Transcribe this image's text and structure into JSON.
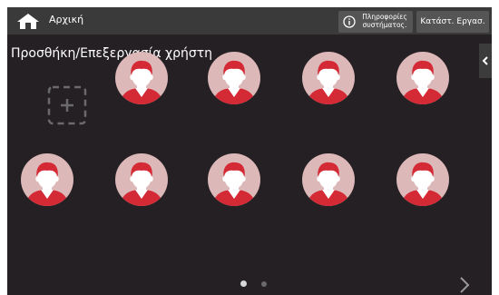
{
  "topbar": {
    "home_label": "Αρχική",
    "system_info_label": "Πληροφορίες συστήματος.",
    "job_status_label": "Κατάστ. Εργασ.",
    "home_icon": "home-icon",
    "info_icon": "info-icon"
  },
  "main": {
    "title": "Προσθήκη/Επεξεργασία χρήστη",
    "side_tab_icon": "chevron-left-icon",
    "add_user_icon": "add-user-icon",
    "user_avatar_icon": "user-avatar-icon",
    "user_count_visible": 9
  },
  "pager": {
    "pages": 2,
    "current": 1,
    "next_icon": "chevron-right-icon"
  },
  "colors": {
    "background": "#242024",
    "topbar": "#3a3a3a",
    "button": "#555555",
    "avatar_bg": "#dcb8b8",
    "avatar_accent": "#d42a36"
  }
}
